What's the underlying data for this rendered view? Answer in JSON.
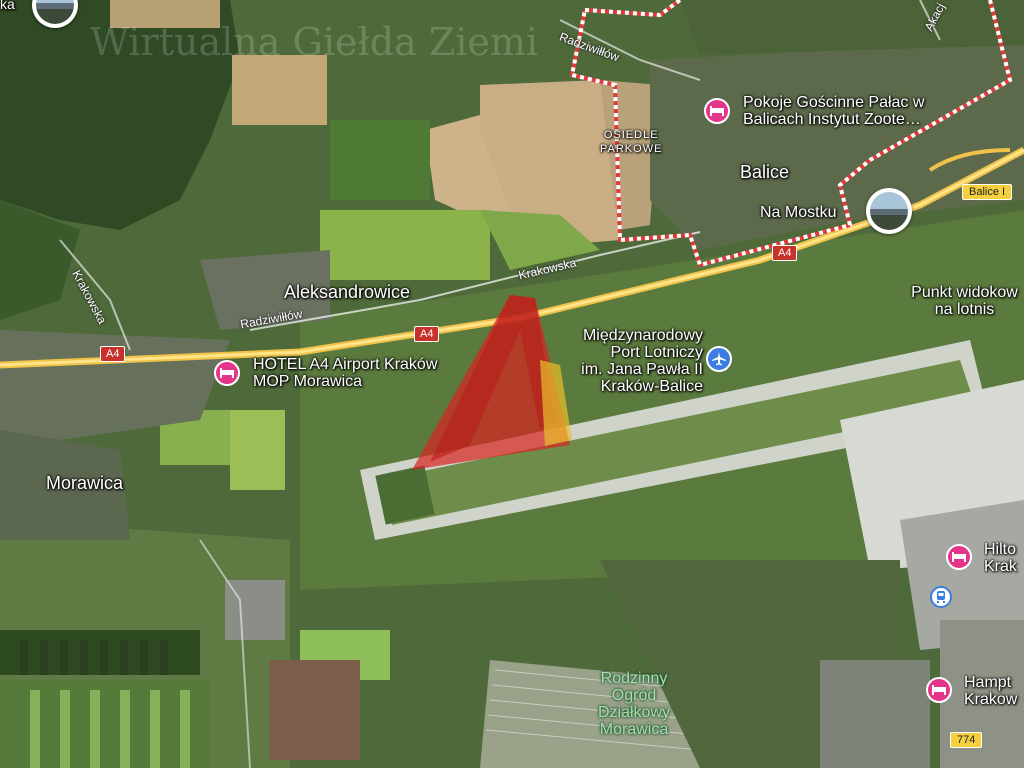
{
  "map": {
    "watermark": "Wirtualna Giełda Ziemi",
    "top_left_fragment": "ka",
    "places": {
      "aleksandrowice": "Aleksandrowice",
      "morawica": "Morawica",
      "balice": "Balice",
      "osiedle": "OSIEDLE\nPARKOWE"
    },
    "roads": {
      "radziwillow_top": "Radziwiłłów",
      "radziwillow_mid": "Radziwiłłów",
      "krakowska_vert": "Krakowska",
      "krakowska_mid": "Krakowska",
      "akacjowa": "Akacj"
    },
    "shields": {
      "a4_left": "A4",
      "a4_mid": "A4",
      "a4_right": "A4",
      "balice_one": "Balice I",
      "route_774": "774"
    },
    "pois": {
      "hotel_a4": "HOTEL A4 Airport Kraków MOP Morawica",
      "pokoje": "Pokoje Gościnne Pałac w Balicach Instytut Zoote…",
      "na_mostku": "Na Mostku",
      "airport": "Międzynarodowy\nPort Lotniczy\nim. Jana Pawła II\nKraków-Balice",
      "punkt": "Punkt widokow\nna lotnis",
      "hilton": "Hilto\nKrak",
      "hampton": "Hampt\nKrakow",
      "ogrod": "Rodzinny\nOgród\nDziałkowy\nMorawica"
    },
    "colors": {
      "marker_red": "#d9231f",
      "marker_yellow": "#e8c02a",
      "poi_pink": "#e5358a",
      "airport_blue": "#3b7de0",
      "boundary": "#ffffff"
    },
    "icons": {
      "hotel": "bed-icon",
      "airport": "airplane-icon",
      "transit": "train-icon",
      "location": "location-pin-icon"
    }
  }
}
